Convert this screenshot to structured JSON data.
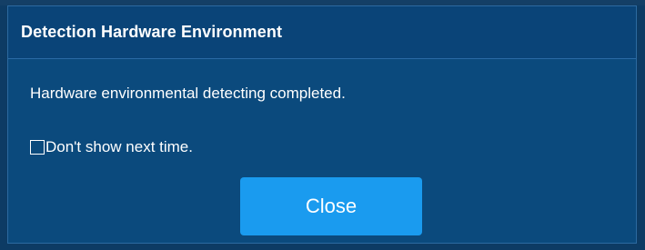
{
  "dialog": {
    "title": "Detection Hardware Environment",
    "message": "Hardware environmental detecting completed.",
    "dont_show_label": "Don't show next time.",
    "dont_show_checked": false,
    "close_label": "Close"
  },
  "colors": {
    "background": "#0d3b64",
    "dialog": "#0b4a7d",
    "header": "#0a4478",
    "button": "#1a9bef",
    "text": "#ffffff"
  }
}
